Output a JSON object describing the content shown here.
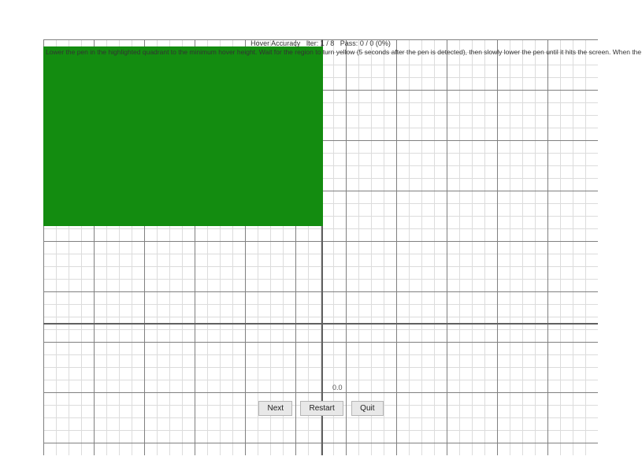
{
  "header": {
    "title": "Hover Accuracy",
    "iter_label": "Iter:",
    "iter_value": "1 / 8",
    "pass_label": "Pass:",
    "pass_value": "0 / 0 (0%)"
  },
  "instruction": "Lower the pen in the highlighted quadrant to the minimum hover height. Wait for the region to turn yellow (5 seconds after the pen is detected), then slowly lower the pen until it hits the screen. When the region turns green again, lift the pen.",
  "axis": {
    "zero_label": "0.0"
  },
  "buttons": {
    "next": "Next",
    "restart": "Restart",
    "quit": "Quit"
  },
  "highlight": {
    "quadrant": "top-left",
    "color": "#138c10"
  }
}
